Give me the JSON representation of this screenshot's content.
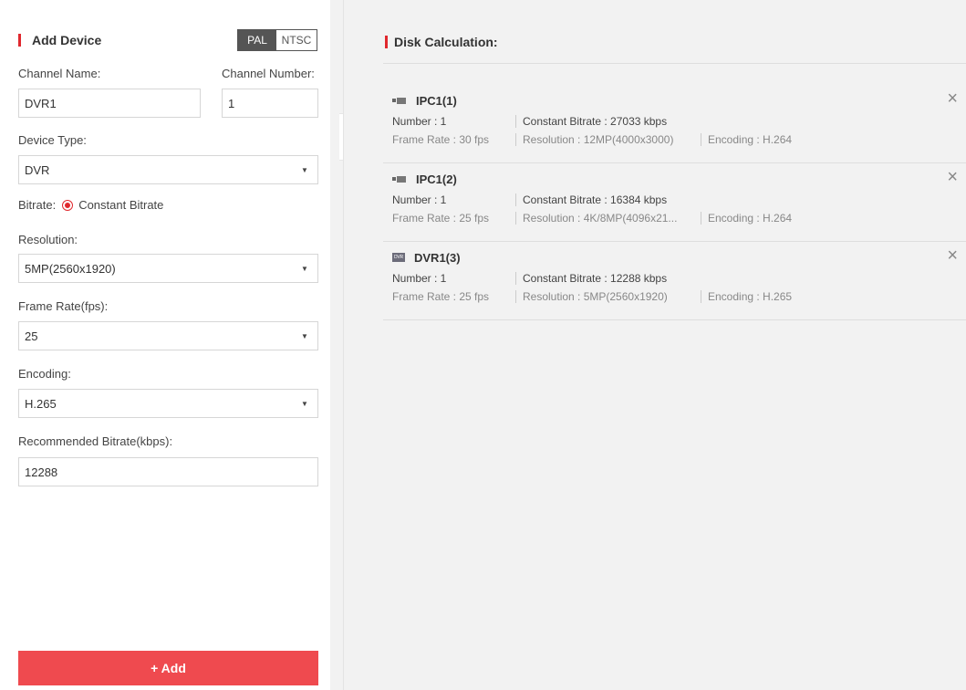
{
  "left_panel": {
    "title": "Add Device",
    "pal_label": "PAL",
    "ntsc_label": "NTSC",
    "channel_name_label": "Channel Name:",
    "channel_number_label": "Channel Number:",
    "channel_name_value": "DVR1",
    "channel_number_value": "1",
    "device_type_label": "Device Type:",
    "device_type_value": "DVR",
    "bitrate_label": "Bitrate:",
    "bitrate_option": "Constant Bitrate",
    "resolution_label": "Resolution:",
    "resolution_value": "5MP(2560x1920)",
    "frame_rate_label": "Frame Rate(fps):",
    "frame_rate_value": "25",
    "encoding_label": "Encoding:",
    "encoding_value": "H.265",
    "recommended_bitrate_label": "Recommended Bitrate(kbps):",
    "recommended_bitrate_value": "12288",
    "add_button": "+ Add"
  },
  "right_panel": {
    "title": "Disk Calculation:",
    "devices": [
      {
        "icon": "camera-icon",
        "name": "IPC1(1)",
        "number": "Number : 1",
        "bitrate": "Constant Bitrate : 27033 kbps",
        "frame_rate": "Frame Rate : 30 fps",
        "resolution": "Resolution : 12MP(4000x3000)",
        "encoding": "Encoding : H.264"
      },
      {
        "icon": "camera-icon",
        "name": "IPC1(2)",
        "number": "Number : 1",
        "bitrate": "Constant Bitrate : 16384 kbps",
        "frame_rate": "Frame Rate : 25 fps",
        "resolution": "Resolution : 4K/8MP(4096x21...",
        "encoding": "Encoding : H.264"
      },
      {
        "icon": "dvr-icon",
        "icon_text": "DVR",
        "name": "DVR1(3)",
        "number": "Number : 1",
        "bitrate": "Constant Bitrate : 12288 kbps",
        "frame_rate": "Frame Rate : 25 fps",
        "resolution": "Resolution : 5MP(2560x1920)",
        "encoding": "Encoding : H.265"
      }
    ]
  },
  "colors": {
    "accent_red": "#e0282e",
    "add_button_red": "#ef4a4f",
    "toggle_dark": "#555555"
  }
}
